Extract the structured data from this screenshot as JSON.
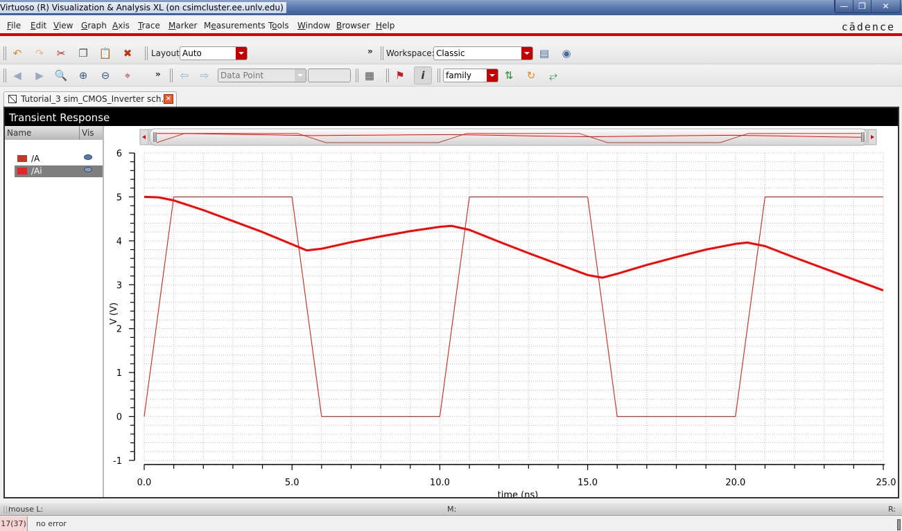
{
  "window": {
    "title": "Virtuoso (R) Visualization & Analysis XL (on csimcluster.ee.unlv.edu)",
    "buttons": [
      "minimize",
      "restore",
      "close"
    ]
  },
  "menu": {
    "items": [
      {
        "label": "File",
        "mnemonic": "F"
      },
      {
        "label": "Edit",
        "mnemonic": "E"
      },
      {
        "label": "View",
        "mnemonic": "V"
      },
      {
        "label": "Graph",
        "mnemonic": "G"
      },
      {
        "label": "Axis",
        "mnemonic": "A"
      },
      {
        "label": "Trace",
        "mnemonic": "T"
      },
      {
        "label": "Marker",
        "mnemonic": "M"
      },
      {
        "label": "Measurements",
        "mnemonic": "e"
      },
      {
        "label": "Tools",
        "mnemonic": "o"
      },
      {
        "label": "Window",
        "mnemonic": "W"
      },
      {
        "label": "Browser",
        "mnemonic": "B"
      },
      {
        "label": "Help",
        "mnemonic": "H"
      }
    ],
    "logo": "cādence"
  },
  "toolbar1": {
    "icons": [
      "undo-icon",
      "redo-icon",
      "cut-icon",
      "copy-icon",
      "paste-icon",
      "delete-icon"
    ],
    "layout_label": "Layout:",
    "layout_value": "Auto",
    "overflow": "»",
    "workspace_label": "Workspace:",
    "workspace_value": "Classic",
    "workspace_icons": [
      "save-workspace-icon",
      "delete-workspace-icon"
    ]
  },
  "toolbar2": {
    "icons": [
      "zoom-prev-icon",
      "zoom-next-icon",
      "zoom-fit-icon",
      "zoom-in-icon",
      "zoom-out-icon",
      "zoom-strip-icon"
    ],
    "overflow": "»",
    "marker_nav": [
      "prev-marker-icon",
      "next-marker-icon"
    ],
    "datapoint_value": "Data Point",
    "datapoint_input": "",
    "calculator": "calculator-icon",
    "flag": "marker-flag-icon",
    "info": "info-balloon-icon",
    "family_value": "family",
    "trace_icons": [
      "split-traces-icon",
      "reload-icon",
      "combine-traces-icon"
    ]
  },
  "tab": {
    "label": "Tutorial_3 sim_CMOS_Inverter sch...",
    "close": "×"
  },
  "panel": {
    "title": "Transient Response",
    "legend_header": {
      "name": "Name",
      "vis": "Vis"
    },
    "traces": [
      {
        "name": "/A",
        "color": "#c0392b",
        "visible": true,
        "selected": false
      },
      {
        "name": "/Ai",
        "color": "#e8242a",
        "visible": true,
        "selected": true
      }
    ]
  },
  "status": {
    "left": "mouse L:",
    "middle": "M:",
    "right": "R:",
    "count": "17(37)",
    "message": "no error"
  },
  "chart_data": {
    "type": "line",
    "title": "Transient Response",
    "xlabel": "time (ns)",
    "ylabel": "V (V)",
    "xlim": [
      0,
      25
    ],
    "ylim": [
      -1,
      6
    ],
    "xticks": [
      0,
      5,
      10,
      15,
      20,
      25
    ],
    "xtick_labels": [
      "0.0",
      "5.0",
      "10.0",
      "15.0",
      "20.0",
      "25.0"
    ],
    "yticks": [
      -1,
      0,
      1,
      2,
      3,
      4,
      5,
      6
    ],
    "ytick_labels": [
      "-1",
      "0",
      "1",
      "2",
      "3",
      "4",
      "5",
      "6"
    ],
    "x_minor_step": 1,
    "y_minor_step": 0.2,
    "grid": true,
    "legend": "left-panel",
    "series": [
      {
        "name": "/A",
        "color": "#c0392b",
        "width": "thin",
        "x": [
          0,
          1,
          5,
          6,
          10,
          11,
          15,
          16,
          20,
          21,
          25
        ],
        "y": [
          0,
          5,
          5,
          0,
          0,
          5,
          5,
          0,
          0,
          5,
          5
        ]
      },
      {
        "name": "/Ai",
        "color": "#ff0000",
        "width": "thick",
        "x": [
          0,
          0.5,
          1,
          2,
          3,
          4,
          5,
          5.5,
          6,
          7,
          8,
          9,
          10,
          10.4,
          11,
          12,
          13,
          14,
          15,
          15.5,
          16,
          17,
          18,
          19,
          20,
          20.4,
          21,
          22,
          23,
          24,
          25
        ],
        "y": [
          5.0,
          4.99,
          4.92,
          4.7,
          4.45,
          4.2,
          3.92,
          3.78,
          3.82,
          3.97,
          4.1,
          4.22,
          4.32,
          4.34,
          4.25,
          3.98,
          3.72,
          3.47,
          3.22,
          3.16,
          3.25,
          3.45,
          3.63,
          3.8,
          3.93,
          3.96,
          3.88,
          3.62,
          3.37,
          3.12,
          2.87
        ]
      }
    ],
    "overview_strip": {
      "present": true,
      "range": [
        0,
        25
      ]
    }
  }
}
